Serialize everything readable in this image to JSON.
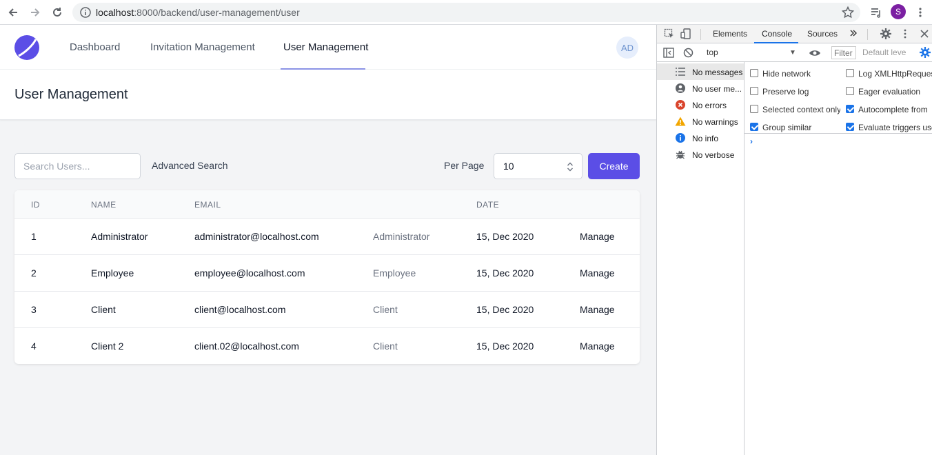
{
  "browser": {
    "url_host": "localhost",
    "url_rest": ":8000/backend/user-management/user",
    "profile_initial": "S"
  },
  "app": {
    "nav": {
      "links": [
        "Dashboard",
        "Invitation Management",
        "User Management"
      ],
      "active_index": 2,
      "avatar": "AD"
    },
    "page_title": "User Management",
    "toolbar": {
      "search_placeholder": "Search Users...",
      "advanced_search": "Advanced Search",
      "per_page_label": "Per Page",
      "per_page_value": "10",
      "create_label": "Create"
    },
    "table": {
      "headers": [
        "ID",
        "NAME",
        "EMAIL",
        "DATE"
      ],
      "rows": [
        {
          "id": "1",
          "name": "Administrator",
          "email": "administrator@localhost.com",
          "role": "Administrator",
          "date": "15, Dec 2020",
          "action": "Manage"
        },
        {
          "id": "2",
          "name": "Employee",
          "email": "employee@localhost.com",
          "role": "Employee",
          "date": "15, Dec 2020",
          "action": "Manage"
        },
        {
          "id": "3",
          "name": "Client",
          "email": "client@localhost.com",
          "role": "Client",
          "date": "15, Dec 2020",
          "action": "Manage"
        },
        {
          "id": "4",
          "name": "Client 2",
          "email": "client.02@localhost.com",
          "role": "Client",
          "date": "15, Dec 2020",
          "action": "Manage"
        }
      ]
    },
    "colors": {
      "primary": "#5b4ee6",
      "nav_underline": "#8b93e6"
    }
  },
  "devtools": {
    "tabs": [
      "Elements",
      "Console",
      "Sources"
    ],
    "active_tab": "Console",
    "context": "top",
    "filter_placeholder": "Filter",
    "default_levels": "Default leve",
    "sidebar": [
      {
        "label": "No messages",
        "icon": "list-icon"
      },
      {
        "label": "No user me...",
        "icon": "user-icon"
      },
      {
        "label": "No errors",
        "icon": "error-icon"
      },
      {
        "label": "No warnings",
        "icon": "warning-icon"
      },
      {
        "label": "No info",
        "icon": "info-icon"
      },
      {
        "label": "No verbose",
        "icon": "bug-icon"
      }
    ],
    "settings": [
      {
        "label": "Hide network",
        "checked": false
      },
      {
        "label": "Log XMLHttpReques",
        "checked": false
      },
      {
        "label": "Preserve log",
        "checked": false
      },
      {
        "label": "Eager evaluation",
        "checked": false
      },
      {
        "label": "Selected context only",
        "checked": false
      },
      {
        "label": "Autocomplete from",
        "checked": true
      },
      {
        "label": "Group similar",
        "checked": true
      },
      {
        "label": "Evaluate triggers use",
        "checked": true
      }
    ],
    "prompt": "›"
  }
}
